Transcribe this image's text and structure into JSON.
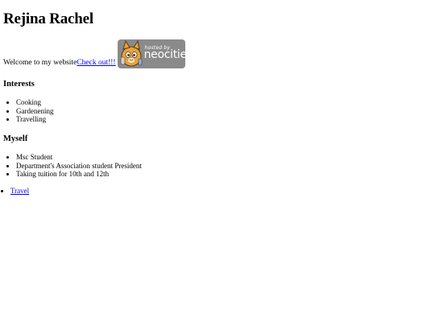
{
  "page": {
    "heading": "Rejina Rachel"
  },
  "welcome": {
    "text": "Welcome to my website ",
    "link_label": "Check out!!!"
  },
  "badge": {
    "hosted_text": "hosted by",
    "brand_text": "neocities",
    "background_color": "#8a8a8a"
  },
  "interests": {
    "heading": "Interests",
    "items": [
      "Cooking",
      "Gardenening",
      "Travelling"
    ]
  },
  "myself": {
    "heading": "Myself",
    "items": [
      "Msc Student",
      "Department's Association student President",
      "Taking tuition for 10th and 12th"
    ]
  },
  "links": {
    "items": [
      "Travel"
    ]
  },
  "colors": {
    "link": "#0000ee",
    "text": "#000000",
    "background": "#ffffff"
  }
}
